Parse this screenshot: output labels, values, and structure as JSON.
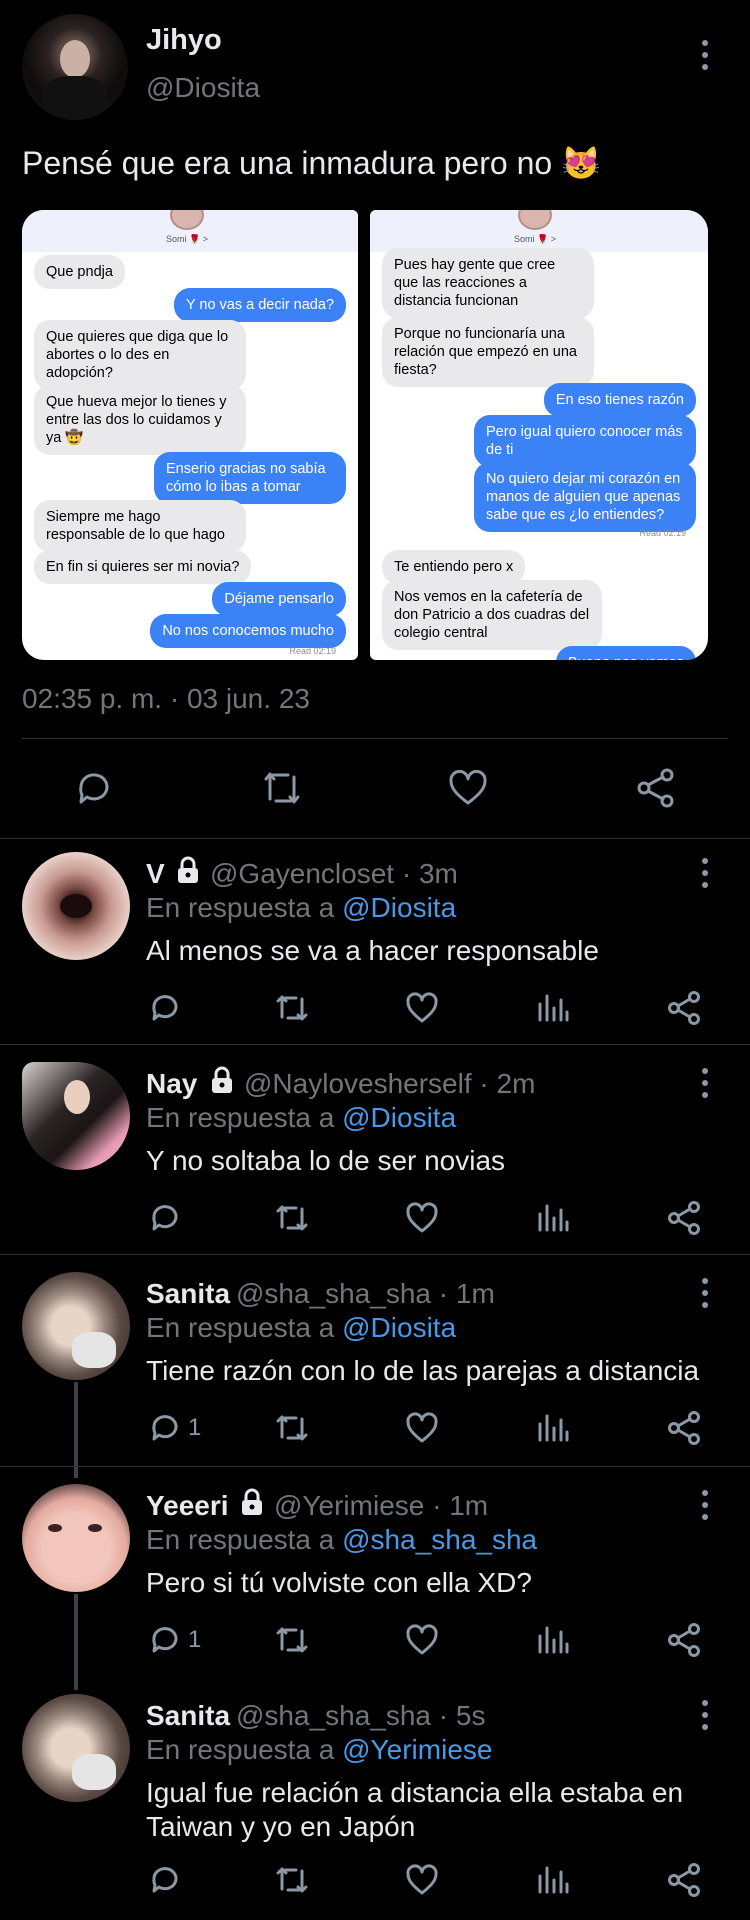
{
  "main_tweet": {
    "name": "Jihyo",
    "handle": "@Diosita",
    "text": "Pensé que era una inmadura pero no 😻",
    "timestamp": "02:35 p. m. · 03 jun. 23",
    "menu_icon": "more-vertical-icon",
    "actions": [
      "reply-icon",
      "retweet-icon",
      "like-icon",
      "share-icon"
    ]
  },
  "screenshot_left": {
    "contact": "Somi 🌹 >",
    "messages": [
      {
        "from": "them",
        "text": "Que pndja"
      },
      {
        "from": "me",
        "text": "Y no vas a decir nada?"
      },
      {
        "from": "them",
        "text": "Que quieres que diga que lo abortes o lo des en adopción?"
      },
      {
        "from": "them",
        "text": "Que hueva mejor lo tienes y entre las dos lo cuidamos y ya 🤠"
      },
      {
        "from": "me",
        "text": "Enserio gracias no sabía cómo lo ibas a tomar"
      },
      {
        "from": "them",
        "text": "Siempre me hago responsable de lo que hago"
      },
      {
        "from": "them",
        "text": "En fin si quieres ser mi novia?"
      },
      {
        "from": "me",
        "text": "Déjame pensarlo"
      },
      {
        "from": "me",
        "text": "No nos conocemos mucho"
      }
    ],
    "read": "Read 02:19"
  },
  "screenshot_right": {
    "contact": "Somi 🌹 >",
    "messages": [
      {
        "from": "them",
        "text": "Pues hay gente que cree que las reacciones a distancia funcionan"
      },
      {
        "from": "them",
        "text": "Porque no funcionaría una relación que empezó en una fiesta?"
      },
      {
        "from": "me",
        "text": "En eso tienes razón"
      },
      {
        "from": "me",
        "text": "Pero igual quiero conocer más de ti"
      },
      {
        "from": "me",
        "text": "No quiero dejar mi corazón en manos de alguien que apenas sabe que es ¿lo entiendes?"
      },
      {
        "from": "them",
        "text": "Te entiendo pero x"
      },
      {
        "from": "them",
        "text": "Nos vemos en la cafetería de don Patricio a dos cuadras del colegio central"
      },
      {
        "from": "me",
        "text": "Bueno nos vemos"
      }
    ],
    "read": "Read 02:19"
  },
  "replies": [
    {
      "name": "V",
      "handle": "@Gayencloset · 3m",
      "reply_to_prefix": "En respuesta a ",
      "reply_to": "@Diosita",
      "text": "Al menos se va a hacer responsable",
      "reply_count": "",
      "locked": true
    },
    {
      "name": "Nay",
      "handle": "@Naylovesherself · 2m",
      "reply_to_prefix": "En respuesta a ",
      "reply_to": "@Diosita",
      "text": "Y no soltaba lo de ser novias",
      "reply_count": "",
      "locked": true
    },
    {
      "name": "Sanita",
      "handle": "@sha_sha_sha · 1m",
      "reply_to_prefix": "En respuesta a ",
      "reply_to": "@Diosita",
      "text": "Tiene razón con lo de las parejas a distancia",
      "reply_count": "1",
      "locked": false
    },
    {
      "name": "Yeeeri",
      "handle": "@Yerimiese · 1m",
      "reply_to_prefix": "En respuesta a ",
      "reply_to": "@sha_sha_sha",
      "text": "Pero si tú volviste con ella XD?",
      "reply_count": "1",
      "locked": true
    },
    {
      "name": "Sanita",
      "handle": "@sha_sha_sha · 5s",
      "reply_to_prefix": "En respuesta a ",
      "reply_to": "@Yerimiese",
      "text": "Igual fue relación a distancia ella estaba en Taiwan y yo en Japón",
      "reply_count": "",
      "locked": false
    }
  ],
  "reply_actions": [
    "reply-icon",
    "retweet-icon",
    "like-icon",
    "views-icon",
    "share-icon"
  ],
  "colors": {
    "background": "#000000",
    "text": "#e7e9ea",
    "muted": "#71767b",
    "link": "#4a99e9",
    "bubble_out": "#3b82f6",
    "bubble_in": "#e9e9eb"
  }
}
